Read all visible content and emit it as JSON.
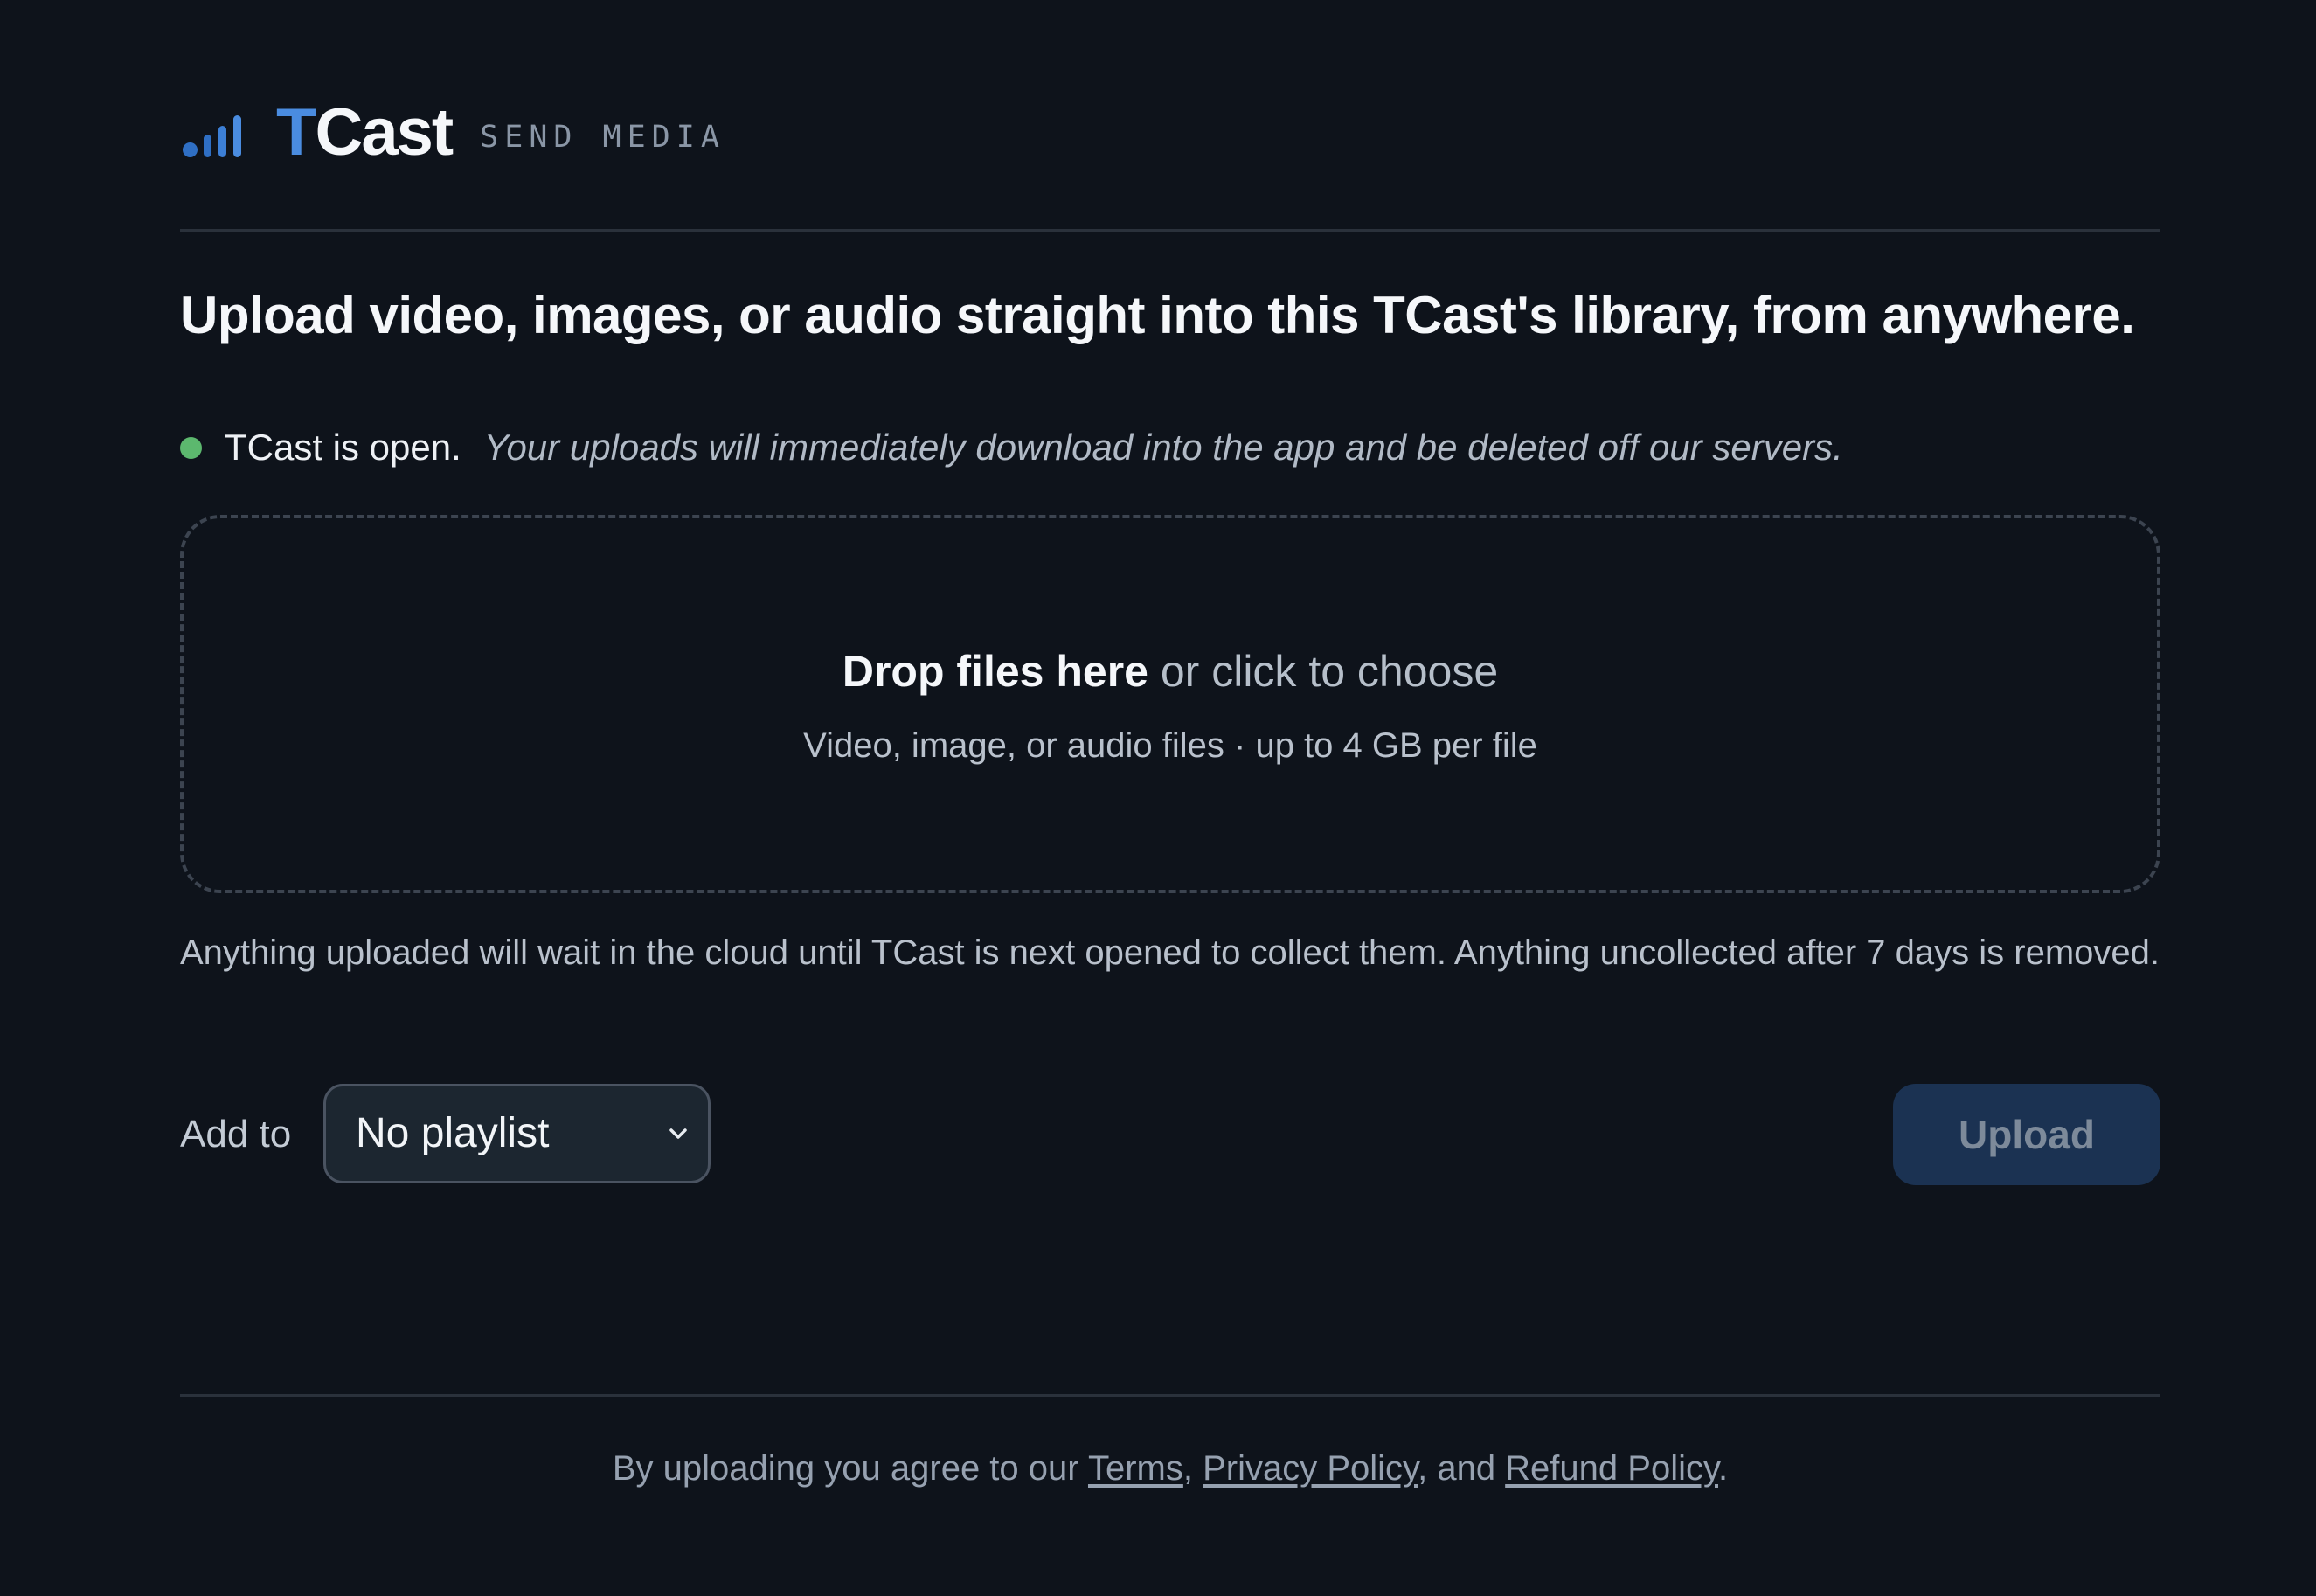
{
  "header": {
    "brand_first": "T",
    "brand_rest": "Cast",
    "subtitle": "SEND MEDIA"
  },
  "headline": "Upload video, images, or audio straight into this TCast's library, from anywhere.",
  "status": {
    "text": "TCast is open.",
    "note": "Your uploads will immediately download into the app and be deleted off our servers."
  },
  "dropzone": {
    "main_strong": "Drop files here",
    "main_rest": " or click to choose",
    "sub": "Video, image, or audio files · up to 4 GB per file"
  },
  "info": "Anything uploaded will wait in the cloud until TCast is next opened to collect them. Anything uncollected after 7 days is removed.",
  "controls": {
    "add_label": "Add to",
    "playlist_value": "No playlist",
    "upload_label": "Upload"
  },
  "footer": {
    "prefix": "By uploading you agree to our ",
    "terms": "Terms",
    "sep1": ", ",
    "privacy": "Privacy Policy",
    "sep2": ", and ",
    "refund": "Refund Policy",
    "suffix": "."
  },
  "colors": {
    "accent": "#4a8ce0",
    "status_open": "#5cb86e",
    "background": "#0e131b"
  },
  "icons": {
    "logo": "signal-bars-icon",
    "select": "chevron-down-icon",
    "status": "status-dot-icon"
  }
}
